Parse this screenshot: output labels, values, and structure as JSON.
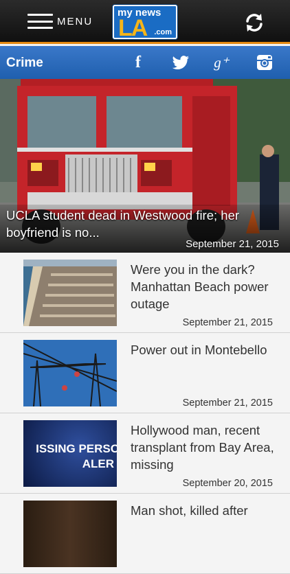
{
  "header": {
    "menu_label": "MENU",
    "logo": {
      "top_text": "my news",
      "main_text": "LA",
      "suffix": ".com"
    }
  },
  "section": {
    "title": "Crime"
  },
  "social": {
    "facebook_glyph": "f",
    "googleplus_glyph": "g⁺",
    "icons": [
      "facebook-icon",
      "twitter-icon",
      "google-plus-icon",
      "instagram-icon"
    ]
  },
  "hero": {
    "title": "UCLA student dead in Westwood fire; her boyfriend is no...",
    "date": "September 21, 2015"
  },
  "articles": [
    {
      "title": "Were you in the dark? Manhattan Beach power outage",
      "date": "September 21, 2015"
    },
    {
      "title": "Power out in Montebello",
      "date": "September 21, 2015"
    },
    {
      "title": "Hollywood man, recent transplant from Bay Area, missing",
      "date": "September 20, 2015",
      "thumb_text_1": "ISSING PERSO",
      "thumb_text_2": "ALER"
    },
    {
      "title": "Man shot, killed after",
      "date": ""
    }
  ],
  "colors": {
    "accent_orange": "#e58a12",
    "section_blue": "#2a6bbd",
    "logo_yellow": "#f5b519"
  }
}
